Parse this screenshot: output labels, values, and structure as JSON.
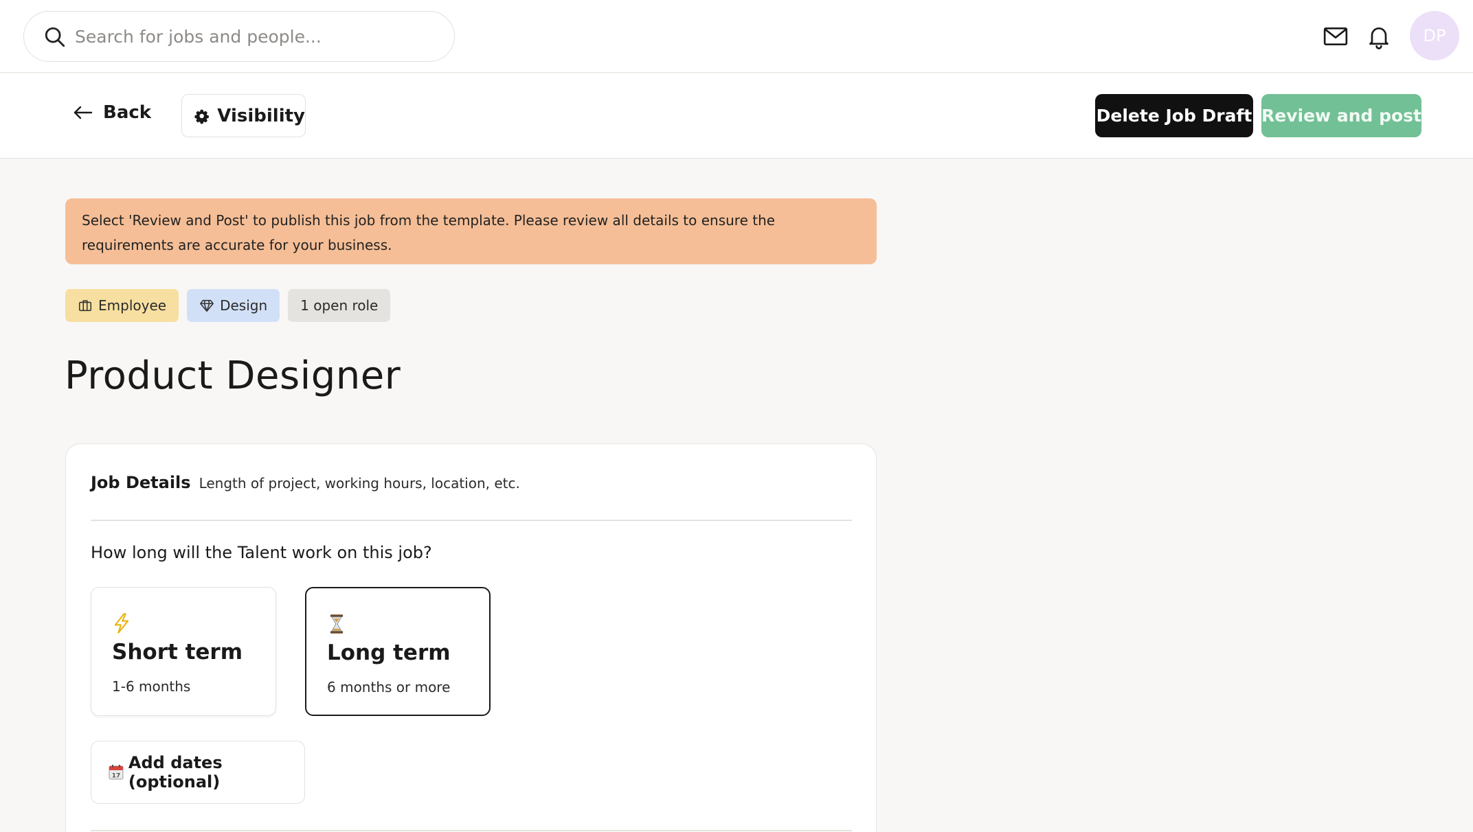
{
  "search": {
    "placeholder": "Search for jobs and people..."
  },
  "header": {
    "avatar_initials": "DP"
  },
  "actions": {
    "back_label": "Back",
    "visibility_label": "Visibility",
    "delete_label": "Delete Job Draft",
    "review_label": "Review and post"
  },
  "banner": {
    "text": "Select 'Review and Post' to publish this job from the template. Please review all details to ensure the requirements are accurate for your business."
  },
  "tags": {
    "employee": "Employee",
    "design": "Design",
    "roles": "1 open role"
  },
  "job": {
    "title": "Product Designer"
  },
  "details": {
    "heading": "Job Details",
    "subheading": "Length of project, working hours, location, etc.",
    "question": "How long will the Talent work on this job?",
    "options": [
      {
        "title": "Short term",
        "subtitle": "1-6 months",
        "icon": "lightning-icon",
        "selected": false
      },
      {
        "title": "Long term",
        "subtitle": "6 months or more",
        "icon": "hourglass-icon",
        "selected": true
      }
    ],
    "dates_label": "Add dates (optional)",
    "dates_icon": "calendar-icon"
  },
  "colors": {
    "banner": "#f5be96",
    "review_button": "#72c095",
    "delete_button": "#111111",
    "tag_employee": "#f6dfa0",
    "tag_design": "#d2e0f7",
    "tag_roles": "#e5e3df",
    "avatar": "#ecdff8"
  }
}
